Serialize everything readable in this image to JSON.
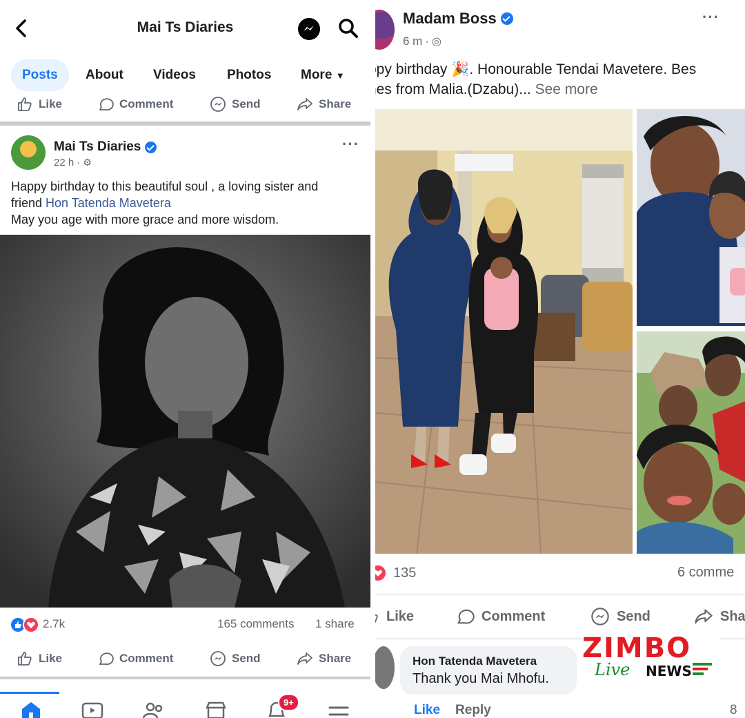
{
  "left": {
    "header": {
      "title": "Mai Ts Diaries"
    },
    "tabs": [
      {
        "label": "Posts",
        "active": true
      },
      {
        "label": "About"
      },
      {
        "label": "Videos"
      },
      {
        "label": "Photos"
      },
      {
        "label": "More"
      }
    ],
    "actions": {
      "like": "Like",
      "comment": "Comment",
      "send": "Send",
      "share": "Share"
    },
    "post": {
      "author": "Mai Ts Diaries",
      "time": "22 h",
      "text_line1": "Happy birthday to this beautiful soul  , a loving sister and",
      "text_line2_prefix": "friend",
      "text_link": "Hon Tatenda Mavetera",
      "text_line3": "May you age with more grace and more wisdom.",
      "reaction_count": "2.7k",
      "comments": "165 comments",
      "shares": "1 share"
    },
    "bottom_nav": {
      "badge": "9+"
    }
  },
  "right": {
    "post": {
      "author": "Madam Boss",
      "time": "6 m",
      "text_line1": "ppy birthday 🎉. Honourable Tendai Mavetere. Bes",
      "text_line2": "hes from Malia.(Dzabu)...",
      "see_more": "See more",
      "reaction_count": "135",
      "comments": "6 comme"
    },
    "actions": {
      "like": "Like",
      "comment": "Comment",
      "send": "Send",
      "share": "Sha"
    },
    "comment": {
      "author": "Hon Tatenda Mavetera",
      "text": "Thank you Mai Mhofu.",
      "like": "Like",
      "reply": "Reply",
      "count": "8"
    },
    "watermark": {
      "zimbo": "ZIMBO",
      "live": "Live",
      "news": "NEWS"
    }
  },
  "colors": {
    "facebook_blue": "#1877f2",
    "link": "#385898",
    "love_red": "#f33e58",
    "brand_red": "#e31b23",
    "brand_green": "#1d8a2e"
  }
}
